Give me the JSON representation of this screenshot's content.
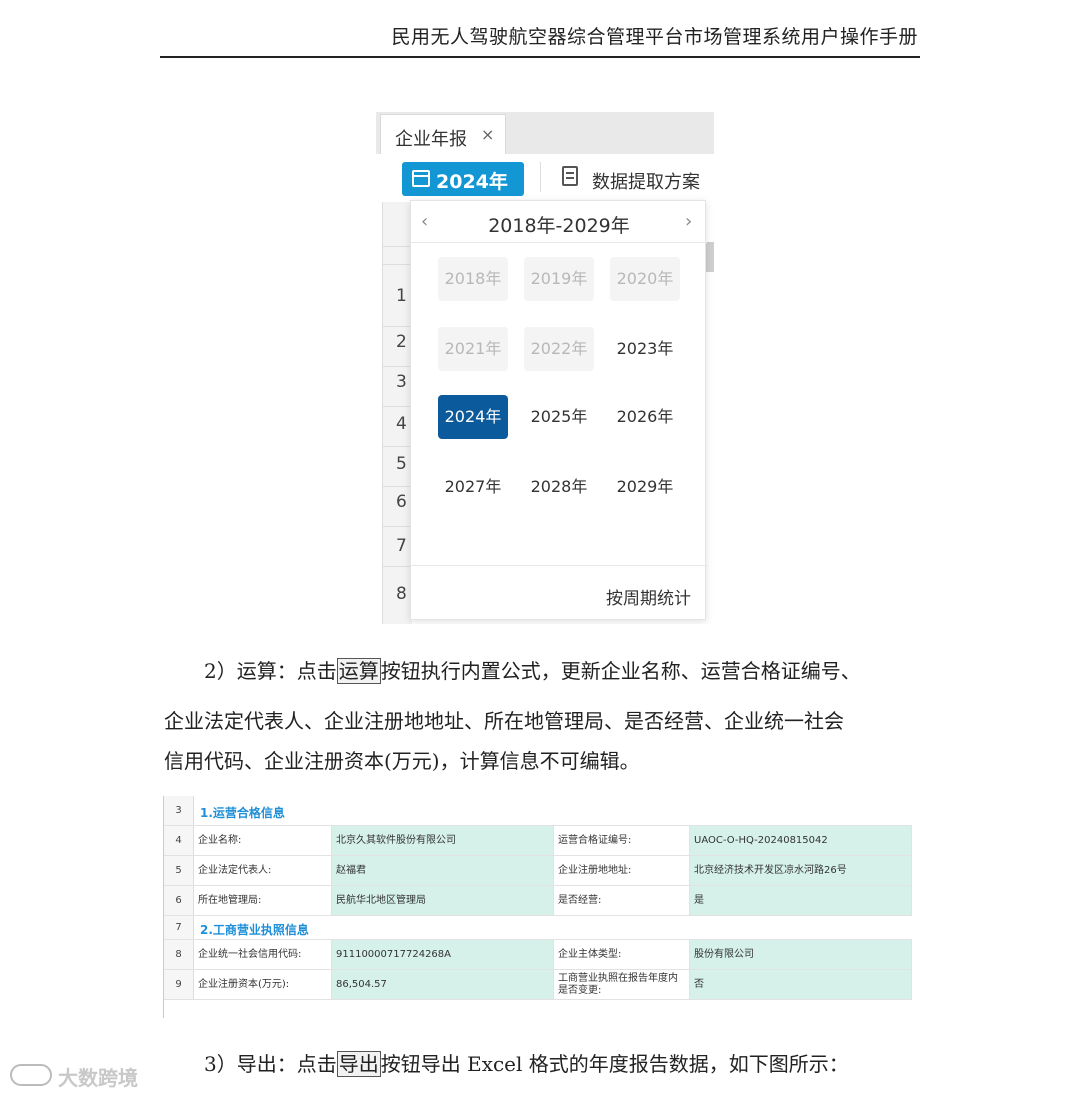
{
  "header": {
    "title": "民用无人驾驶航空器综合管理平台市场管理系统用户操作手册"
  },
  "screenshot1": {
    "tab_label": "企业年报",
    "tab_close": "×",
    "year_button": "2024年",
    "extract_button": "数据提取方案",
    "row_numbers": [
      "1",
      "2",
      "3",
      "4",
      "5",
      "6",
      "7",
      "8"
    ],
    "picker": {
      "prev": "‹",
      "next": "›",
      "range": "2018年-2029年",
      "years": [
        {
          "label": "2018年",
          "state": "disabled"
        },
        {
          "label": "2019年",
          "state": "disabled"
        },
        {
          "label": "2020年",
          "state": "disabled"
        },
        {
          "label": "2021年",
          "state": "disabled"
        },
        {
          "label": "2022年",
          "state": "disabled"
        },
        {
          "label": "2023年",
          "state": "normal"
        },
        {
          "label": "2024年",
          "state": "selected"
        },
        {
          "label": "2025年",
          "state": "normal"
        },
        {
          "label": "2026年",
          "state": "normal"
        },
        {
          "label": "2027年",
          "state": "normal"
        },
        {
          "label": "2028年",
          "state": "normal"
        },
        {
          "label": "2029年",
          "state": "normal"
        }
      ],
      "footer": "按周期统计"
    },
    "colors": {
      "primary": "#1296d4",
      "selected": "#0b5a9c"
    }
  },
  "para2": {
    "line1_pre": "2）运算：点击",
    "line1_box": "运算",
    "line1_post": "按钮执行内置公式，更新企业名称、运营合格证编号、",
    "line2": "企业法定代表人、企业注册地地址、所在地管理局、是否经营、企业统一社会",
    "line3": "信用代码、企业注册资本(万元)，计算信息不可编辑。"
  },
  "screenshot2": {
    "rows": [
      {
        "n": "3",
        "section": "1.运营合格信息"
      },
      {
        "n": "4",
        "cells": [
          "企业名称:",
          "北京久其软件股份有限公司",
          "运营合格证编号:",
          "UAOC-O-HQ-20240815042"
        ]
      },
      {
        "n": "5",
        "cells": [
          "企业法定代表人:",
          "赵福君",
          "企业注册地地址:",
          "北京经济技术开发区凉水河路26号"
        ]
      },
      {
        "n": "6",
        "cells": [
          "所在地管理局:",
          "民航华北地区管理局",
          "是否经营:",
          "是"
        ]
      },
      {
        "n": "7",
        "section": "2.工商营业执照信息"
      },
      {
        "n": "8",
        "cells": [
          "企业统一社会信用代码:",
          "91110000717724268A",
          "企业主体类型:",
          "股份有限公司"
        ]
      },
      {
        "n": "9",
        "cells": [
          "企业注册资本(万元):",
          "86,504.57",
          "工商营业执照在报告年度内是否变更:",
          "否"
        ]
      }
    ],
    "colors": {
      "teal": "#d6f1ea",
      "section": "#1f8fd8"
    }
  },
  "para3": {
    "pre": "3）导出：点击",
    "box": "导出",
    "post": "按钮导出 Excel 格式的年度报告数据，如下图所示："
  },
  "watermark": {
    "text": "大数跨境"
  }
}
